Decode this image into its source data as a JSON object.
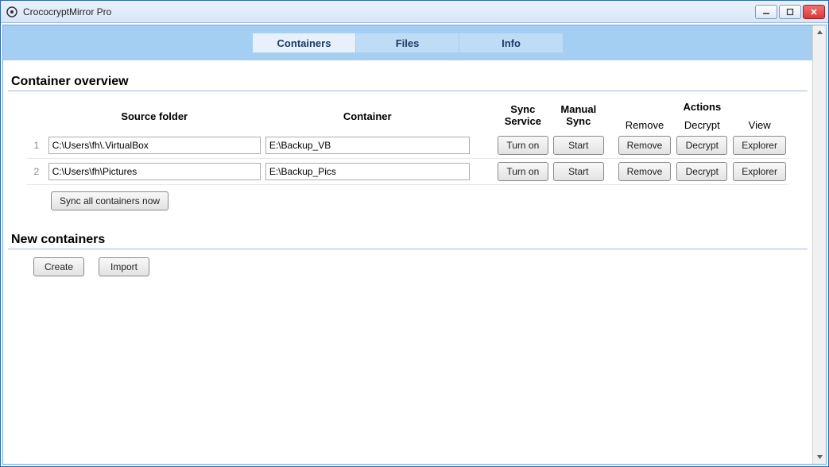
{
  "window": {
    "title": "CrococryptMirror Pro"
  },
  "tabs": [
    {
      "label": "Containers",
      "active": true
    },
    {
      "label": "Files",
      "active": false
    },
    {
      "label": "Info",
      "active": false
    }
  ],
  "sections": {
    "overview_title": "Container overview",
    "new_title": "New containers"
  },
  "headers": {
    "source": "Source folder",
    "container": "Container",
    "sync_service": "Sync Service",
    "manual_sync": "Manual Sync",
    "actions": "Actions",
    "remove": "Remove",
    "decrypt": "Decrypt",
    "view": "View"
  },
  "rows": [
    {
      "num": "1",
      "source": "C:\\Users\\fh\\.VirtualBox",
      "container": "E:\\Backup_VB",
      "sync_label": "Turn on",
      "manual_label": "Start",
      "remove_label": "Remove",
      "decrypt_label": "Decrypt",
      "view_label": "Explorer"
    },
    {
      "num": "2",
      "source": "C:\\Users\\fh\\Pictures",
      "container": "E:\\Backup_Pics",
      "sync_label": "Turn on",
      "manual_label": "Start",
      "remove_label": "Remove",
      "decrypt_label": "Decrypt",
      "view_label": "Explorer"
    }
  ],
  "buttons": {
    "sync_all": "Sync all containers now",
    "create": "Create",
    "import": "Import"
  }
}
